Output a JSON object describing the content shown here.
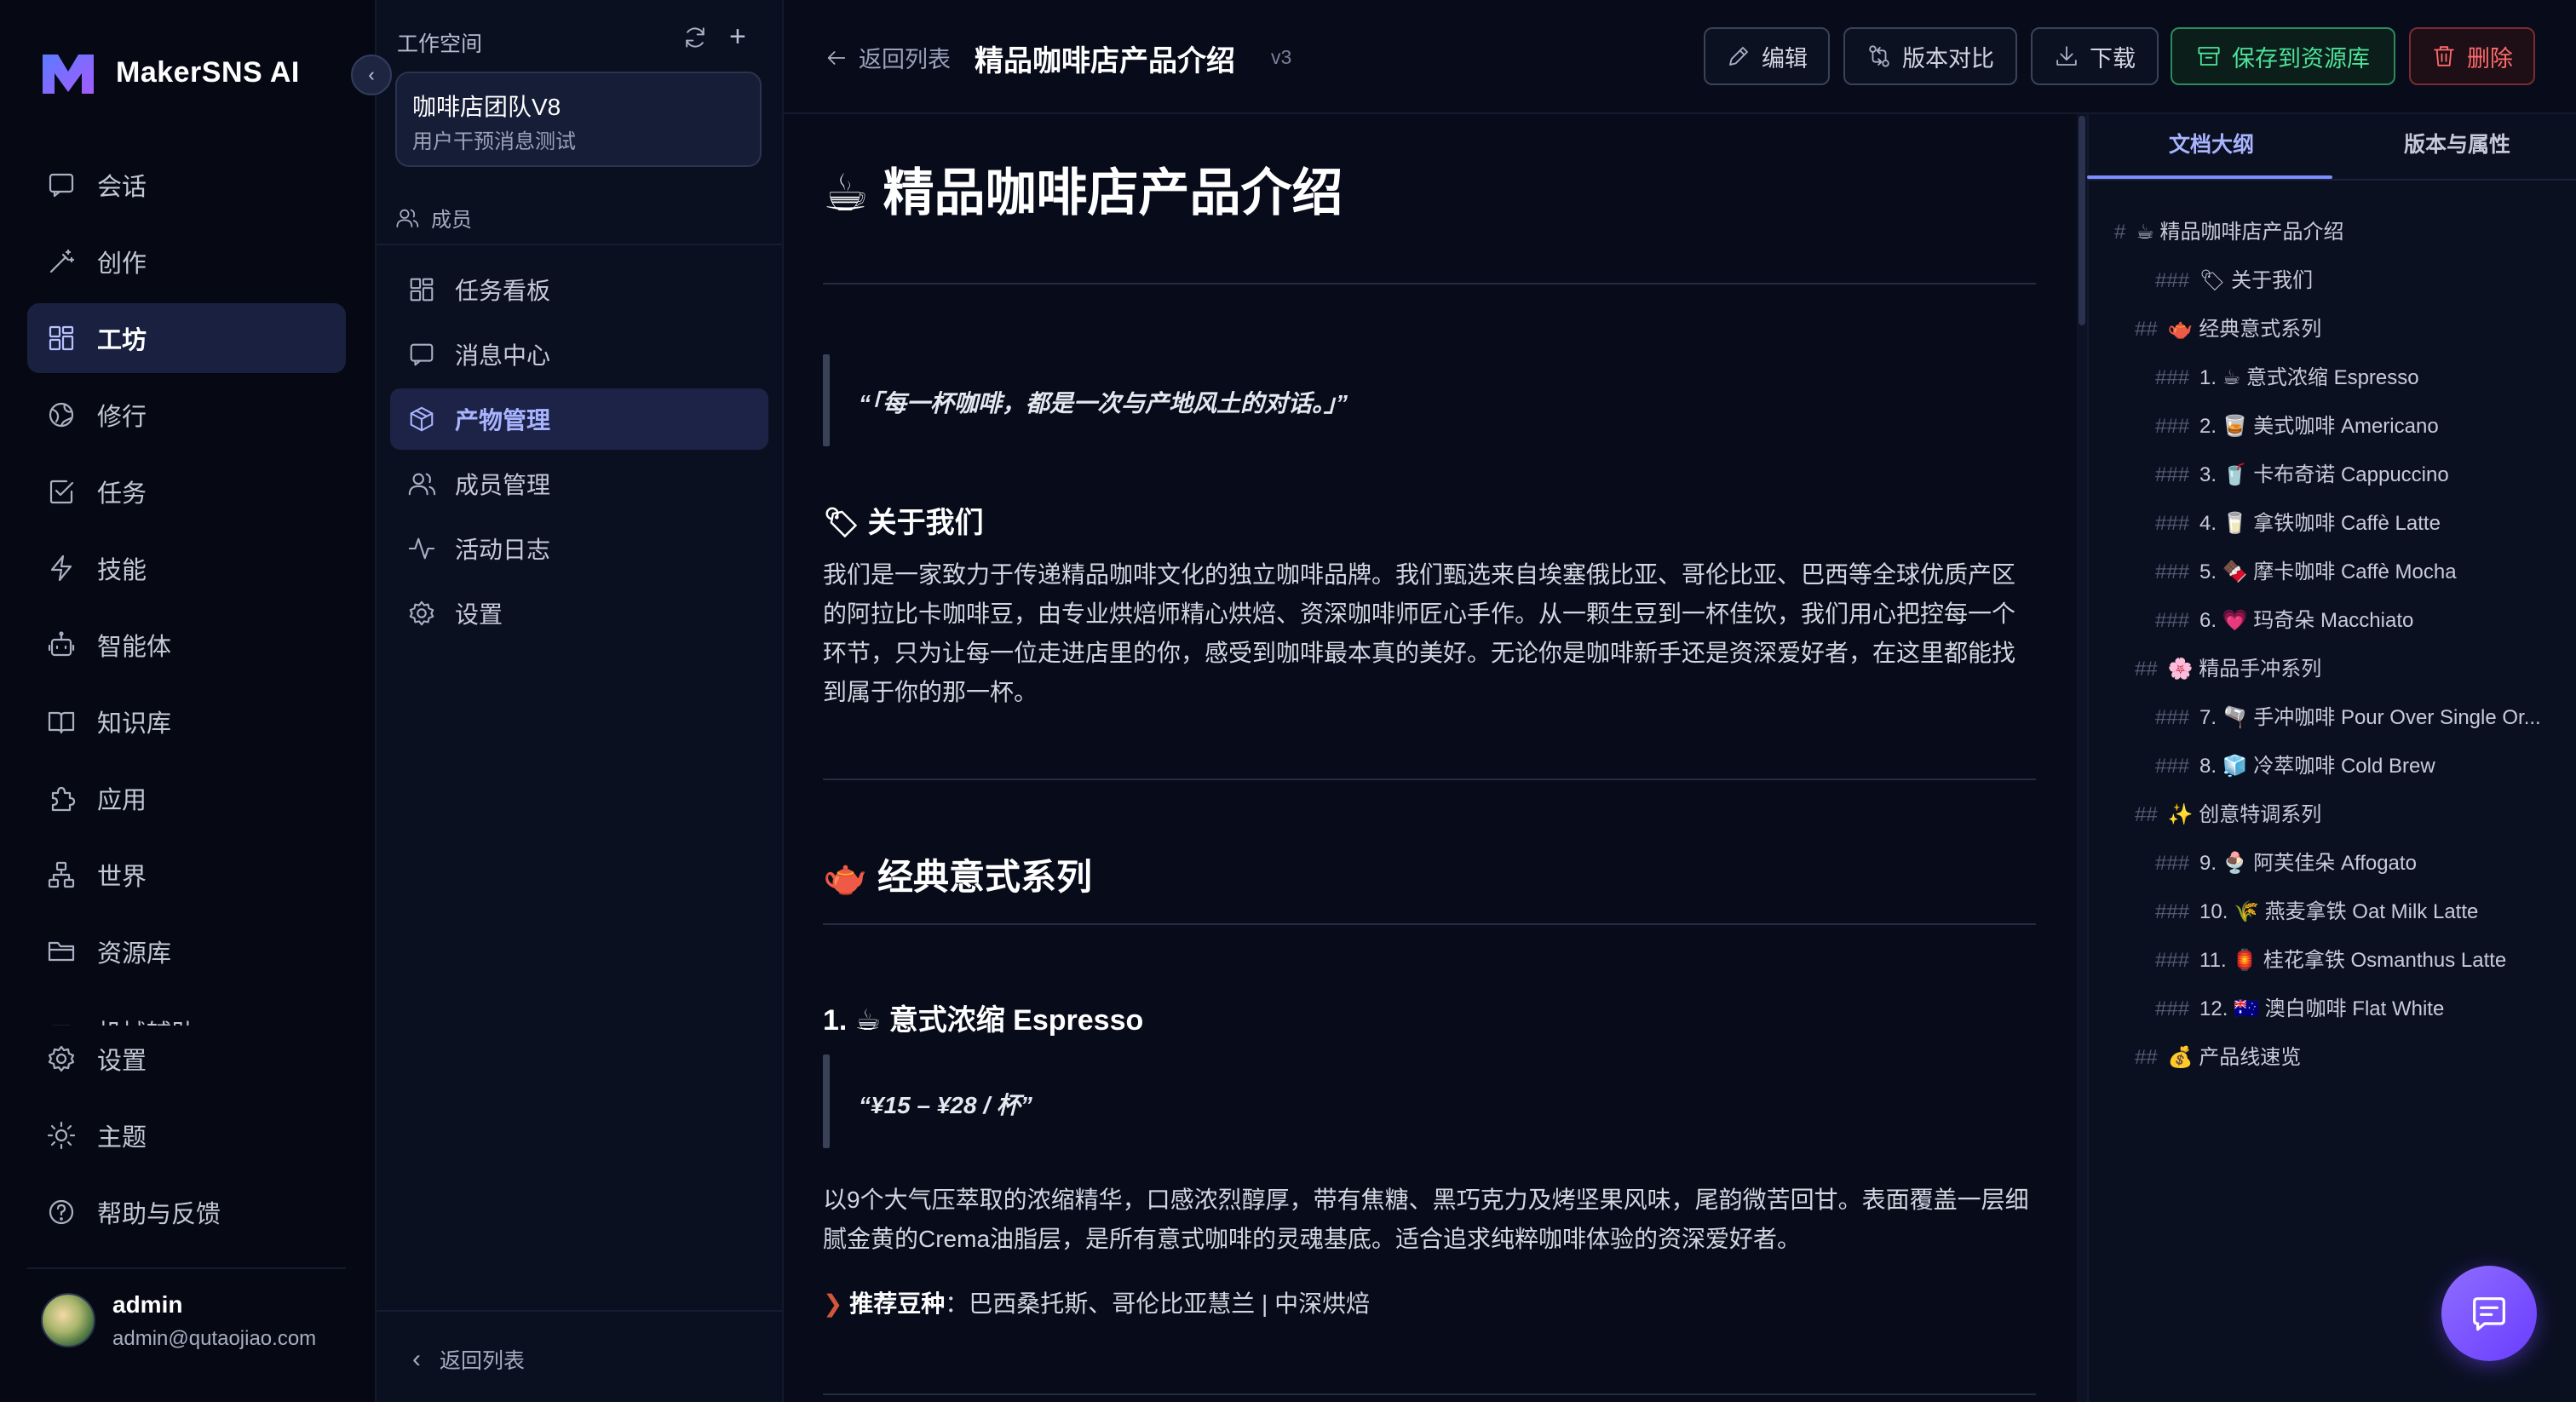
{
  "app": {
    "name": "MakerSNS AI"
  },
  "sidebar": {
    "items": [
      {
        "label": "会话",
        "icon": "chat-icon"
      },
      {
        "label": "创作",
        "icon": "magic-wand-icon"
      },
      {
        "label": "工坊",
        "icon": "grid-icon",
        "active": true
      },
      {
        "label": "修行",
        "icon": "globe-icon"
      },
      {
        "label": "任务",
        "icon": "checkbox-icon"
      },
      {
        "label": "技能",
        "icon": "lightning-icon"
      },
      {
        "label": "智能体",
        "icon": "robot-icon"
      },
      {
        "label": "知识库",
        "icon": "book-icon"
      },
      {
        "label": "应用",
        "icon": "puzzle-icon"
      },
      {
        "label": "世界",
        "icon": "network-icon"
      },
      {
        "label": "资源库",
        "icon": "folder-icon"
      }
    ],
    "partial_item": "机械辅助",
    "bottom_items": [
      {
        "label": "设置",
        "icon": "gear-icon"
      },
      {
        "label": "主题",
        "icon": "sun-icon"
      },
      {
        "label": "帮助与反馈",
        "icon": "help-icon"
      }
    ],
    "user": {
      "name": "admin",
      "email": "admin@qutaojiao.com"
    }
  },
  "workspace": {
    "label": "工作空间",
    "card_title": "咖啡店团队V8",
    "card_subtitle": "用户干预消息测试",
    "members_label": "成员",
    "items": [
      {
        "label": "任务看板",
        "icon": "kanban-icon"
      },
      {
        "label": "消息中心",
        "icon": "message-icon"
      },
      {
        "label": "产物管理",
        "icon": "cube-icon",
        "active": true
      },
      {
        "label": "成员管理",
        "icon": "users-icon"
      },
      {
        "label": "活动日志",
        "icon": "activity-icon"
      },
      {
        "label": "设置",
        "icon": "gear-icon"
      }
    ],
    "back_label": "返回列表"
  },
  "header": {
    "back_label": "返回列表",
    "title": "精品咖啡店产品介绍",
    "version": "v3",
    "buttons": {
      "edit": "编辑",
      "compare": "版本对比",
      "download": "下载",
      "save": "保存到资源库",
      "delete": "删除"
    }
  },
  "doc": {
    "title": "精品咖啡店产品介绍",
    "title_emoji": "☕",
    "quote": "“「每一杯咖啡，都是一次与产地风土的对话。」”",
    "about_heading": "关于我们",
    "about_emoji": "🏷",
    "about_text": "我们是一家致力于传递精品咖啡文化的独立咖啡品牌。我们甄选来自埃塞俄比亚、哥伦比亚、巴西等全球优质产区的阿拉比卡咖啡豆，由专业烘焙师精心烘焙、资深咖啡师匠心手作。从一颗生豆到一杯佳饮，我们用心把控每一个环节，只为让每一位走进店里的你，感受到咖啡最本真的美好。无论你是咖啡新手还是资深爱好者，在这里都能找到属于你的那一杯。",
    "section_heading": "经典意式系列",
    "section_emoji": "🫖",
    "item_heading": "1. ☕ 意式浓缩 Espresso",
    "price_quote": "“¥15 – ¥28 / 杯”",
    "item_text": "以9个大气压萃取的浓缩精华，口感浓烈醇厚，带有焦糖、黑巧克力及烤坚果风味，尾韵微苦回甘。表面覆盖一层细腻金黄的Crema油脂层，是所有意式咖啡的灵魂基底。适合追求纯粹咖啡体验的资深爱好者。",
    "bean_label": "推荐豆种",
    "bean_value": "：巴西桑托斯、哥伦比亚慧兰 | 中深烘焙"
  },
  "outline": {
    "tabs": [
      "文档大纲",
      "版本与属性"
    ],
    "items": [
      {
        "hash": "#",
        "text": "☕ 精品咖啡店产品介绍",
        "level": 1
      },
      {
        "hash": "###",
        "text": "🏷 关于我们",
        "level": 3
      },
      {
        "hash": "##",
        "text": "🫖 经典意式系列",
        "level": 2
      },
      {
        "hash": "###",
        "text": "1. ☕ 意式浓缩 Espresso",
        "level": 3
      },
      {
        "hash": "###",
        "text": "2. 🥃 美式咖啡 Americano",
        "level": 3
      },
      {
        "hash": "###",
        "text": "3. 🥤 卡布奇诺 Cappuccino",
        "level": 3
      },
      {
        "hash": "###",
        "text": "4. 🥛 拿铁咖啡 Caffè Latte",
        "level": 3
      },
      {
        "hash": "###",
        "text": "5. 🍫 摩卡咖啡 Caffè Mocha",
        "level": 3
      },
      {
        "hash": "###",
        "text": "6. 💗 玛奇朵 Macchiato",
        "level": 3
      },
      {
        "hash": "##",
        "text": "🌸 精品手冲系列",
        "level": 2
      },
      {
        "hash": "###",
        "text": "7. 🫗 手冲咖啡 Pour Over Single Or...",
        "level": 3
      },
      {
        "hash": "###",
        "text": "8. 🧊 冷萃咖啡 Cold Brew",
        "level": 3
      },
      {
        "hash": "##",
        "text": "✨ 创意特调系列",
        "level": 2
      },
      {
        "hash": "###",
        "text": "9. 🍨 阿芙佳朵 Affogato",
        "level": 3
      },
      {
        "hash": "###",
        "text": "10. 🌾 燕麦拿铁 Oat Milk Latte",
        "level": 3
      },
      {
        "hash": "###",
        "text": "11. 🏮 桂花拿铁 Osmanthus Latte",
        "level": 3
      },
      {
        "hash": "###",
        "text": "12. 🇦🇺 澳白咖啡 Flat White",
        "level": 3
      },
      {
        "hash": "##",
        "text": "💰 产品线速览",
        "level": 2
      }
    ]
  },
  "colors": {
    "accent": "#7b8cff",
    "save": "#4ee39a",
    "delete": "#ff6b6b",
    "fab": "#7a52ff"
  }
}
